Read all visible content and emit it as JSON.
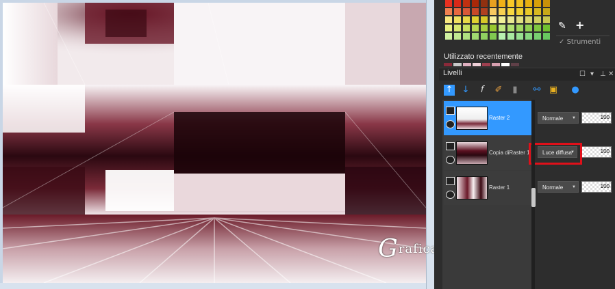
{
  "palette": {
    "swatch_rows": [
      [
        "#e83020",
        "#d82818",
        "#c03010",
        "#a82808",
        "#903010",
        "#e8a020",
        "#f0b018",
        "#f8c828",
        "#f0c020",
        "#e8b010",
        "#d8a008",
        "#c89008"
      ],
      [
        "#f08050",
        "#e86840",
        "#d85838",
        "#c84828",
        "#b04020",
        "#f8c860",
        "#f8d050",
        "#f8d840",
        "#f0d030",
        "#e8c828",
        "#d8b820",
        "#c8a818"
      ],
      [
        "#f8e880",
        "#f0e060",
        "#e8d848",
        "#e0d030",
        "#d8c828",
        "#f8f0a0",
        "#f0f098",
        "#e8e890",
        "#e0e080",
        "#d8d870",
        "#d0d060",
        "#c8c850"
      ],
      [
        "#e8f080",
        "#d8e870",
        "#c8e060",
        "#b8d850",
        "#a8d040",
        "#98c830",
        "#c0e880",
        "#b0e070",
        "#a0d860",
        "#90d050",
        "#80c840",
        "#70c030"
      ],
      [
        "#d0f0a0",
        "#c0e890",
        "#b0e080",
        "#a0d870",
        "#90d060",
        "#80c850",
        "#b8f0b0",
        "#a8e8a0",
        "#98e090",
        "#88d880",
        "#78d070",
        "#68c860"
      ]
    ],
    "recent_colors": [
      "#8a2a3a",
      "#c8c8c8",
      "#e0b0c0",
      "#f0d0d8",
      "#a04050",
      "#d8a0b0",
      "#ffffff",
      "#604048"
    ]
  },
  "tools": {
    "eyedropper_icon": "eyedropper-icon",
    "add_icon": "plus-icon",
    "strumenti_label": "Strumenti"
  },
  "recent": {
    "label": "Utilizzato recentemente"
  },
  "layers_panel": {
    "title": "Livelli",
    "header_icons": [
      "maximize-icon",
      "menu-icon",
      "pin-icon",
      "close-icon"
    ],
    "toolbar_icons": [
      "new-layer-up-icon",
      "new-layer-down-icon",
      "fx-icon",
      "brush-icon",
      "mask-icon",
      "link-icon",
      "lock-icon",
      "globe-icon"
    ],
    "layers": [
      {
        "name": "Raster 2",
        "blend": "Normale",
        "opacity": "100",
        "selected": true
      },
      {
        "name": "Copia diRaster 1",
        "blend": "Luce diffusa",
        "opacity": "100",
        "selected": false
      },
      {
        "name": "Raster 1",
        "blend": "Normale",
        "opacity": "100",
        "selected": false
      }
    ]
  },
  "watermark": {
    "initial": "G",
    "rest": "raficamia"
  },
  "colors": {
    "selected_row": "#3399ff",
    "highlight_box": "#e0101a"
  }
}
